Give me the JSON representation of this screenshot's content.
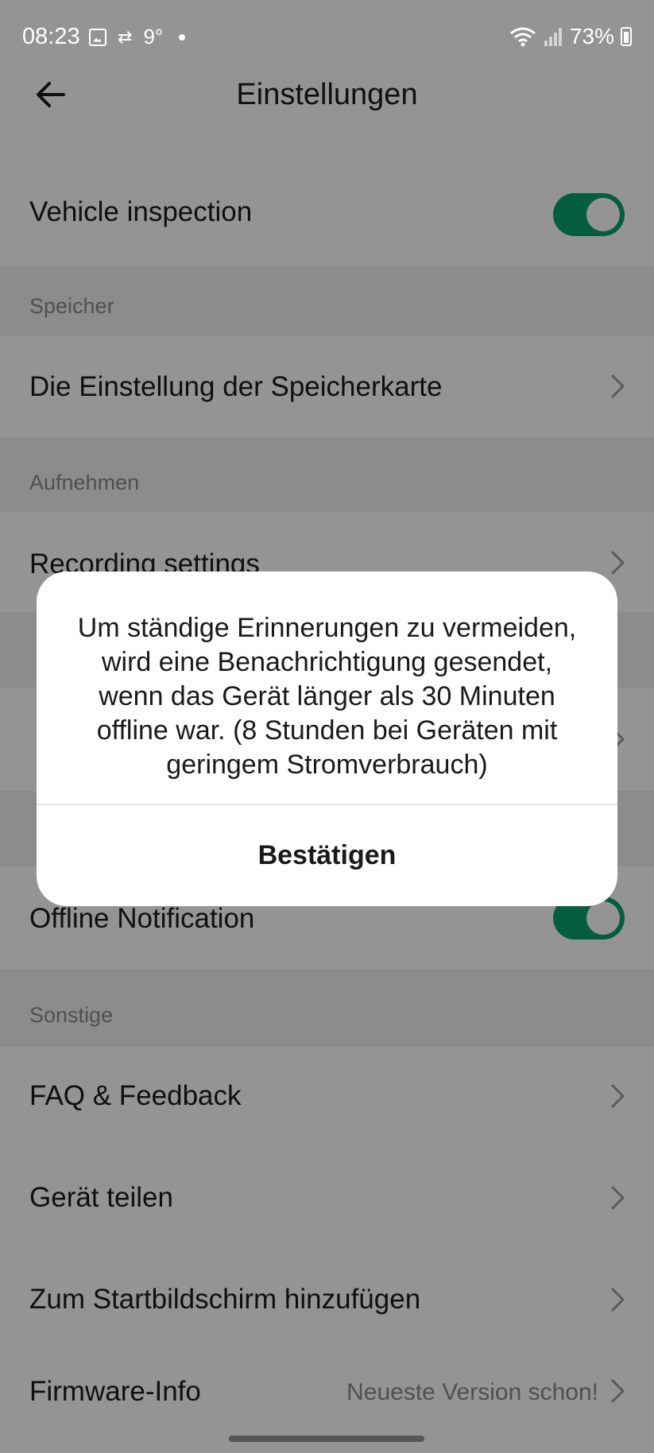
{
  "status_bar": {
    "time": "08:23",
    "temperature": "9°",
    "battery": "73%",
    "icons": [
      "gallery-icon",
      "data-transfer-icon",
      "wifi-icon",
      "signal-icon",
      "battery-icon"
    ]
  },
  "header": {
    "title": "Einstellungen",
    "back_icon": "arrow-left-icon"
  },
  "settings": {
    "vehicle_inspection": {
      "label": "Vehicle inspection",
      "enabled": true
    },
    "storage_section": "Speicher",
    "storage_card": "Die Einstellung der Speicherkarte",
    "record_section": "Aufnehmen",
    "recording_settings": "Recording settings",
    "offline_notification": {
      "label": "Offline Notification",
      "enabled": true
    },
    "other_section": "Sonstige",
    "faq": "FAQ & Feedback",
    "share_device": "Gerät teilen",
    "add_home": "Zum Startbildschirm hinzufügen",
    "firmware": {
      "label": "Firmware-Info",
      "value": "Neueste Version schon!"
    }
  },
  "dialog": {
    "message": "Um ständige Erinnerungen zu vermeiden, wird eine Benachrichtigung gesendet, wenn das Gerät länger als 30 Minuten offline war. (8 Stunden bei Geräten mit geringem Stromverbrauch)",
    "confirm": "Bestätigen"
  },
  "colors": {
    "accent": "#07a36c",
    "overlay": "rgba(0,0,0,0.42)",
    "section_bg": "#f2f2f2"
  }
}
